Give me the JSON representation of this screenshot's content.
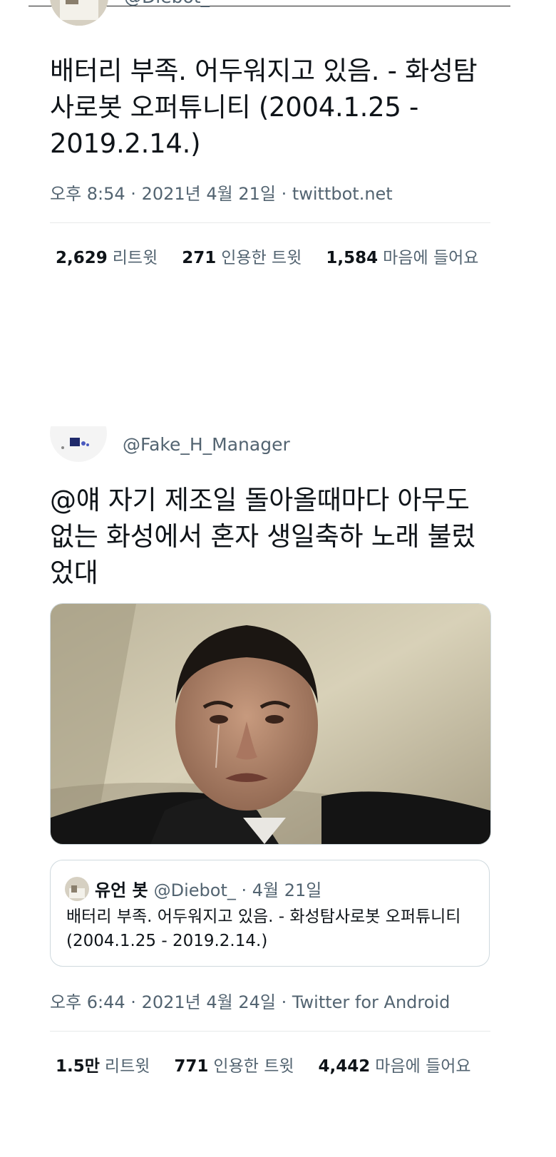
{
  "tweet1": {
    "handle": "@Diebot_",
    "text_line1": "배터리 부족. 어두워지고 있음. - 화성탐",
    "text_line2": "사로봇 오퍼튜니티 (2004.1.25 -",
    "text_line3": "2019.2.14.)",
    "meta": "오후 8:54 · 2021년 4월 21일 · twittbot.net",
    "retweets_count": "2,629",
    "retweets_label": "리트윗",
    "quotes_count": "271",
    "quotes_label": "인용한 트윗",
    "likes_count": "1,584",
    "likes_label": "마음에 들어요"
  },
  "tweet2": {
    "handle": "@Fake_H_Manager",
    "text_line1": "@얘 자기 제조일 돌아올때마다 아무도",
    "text_line2": "없는 화성에서 혼자 생일축하 노래 불렀",
    "text_line3": "었대",
    "quote": {
      "name": "유언 봇",
      "handle_date": "@Diebot_ · 4월 21일",
      "text_line1": "배터리 부족. 어두워지고 있음. - 화성탐사로봇 오퍼튜니티",
      "text_line2": "(2004.1.25 - 2019.2.14.)"
    },
    "meta": "오후 6:44 · 2021년 4월 24일 · Twitter for Android",
    "retweets_count": "1.5만",
    "retweets_label": "리트윗",
    "quotes_count": "771",
    "quotes_label": "인용한 트윗",
    "likes_count": "4,442",
    "likes_label": "마음에 들어요"
  }
}
